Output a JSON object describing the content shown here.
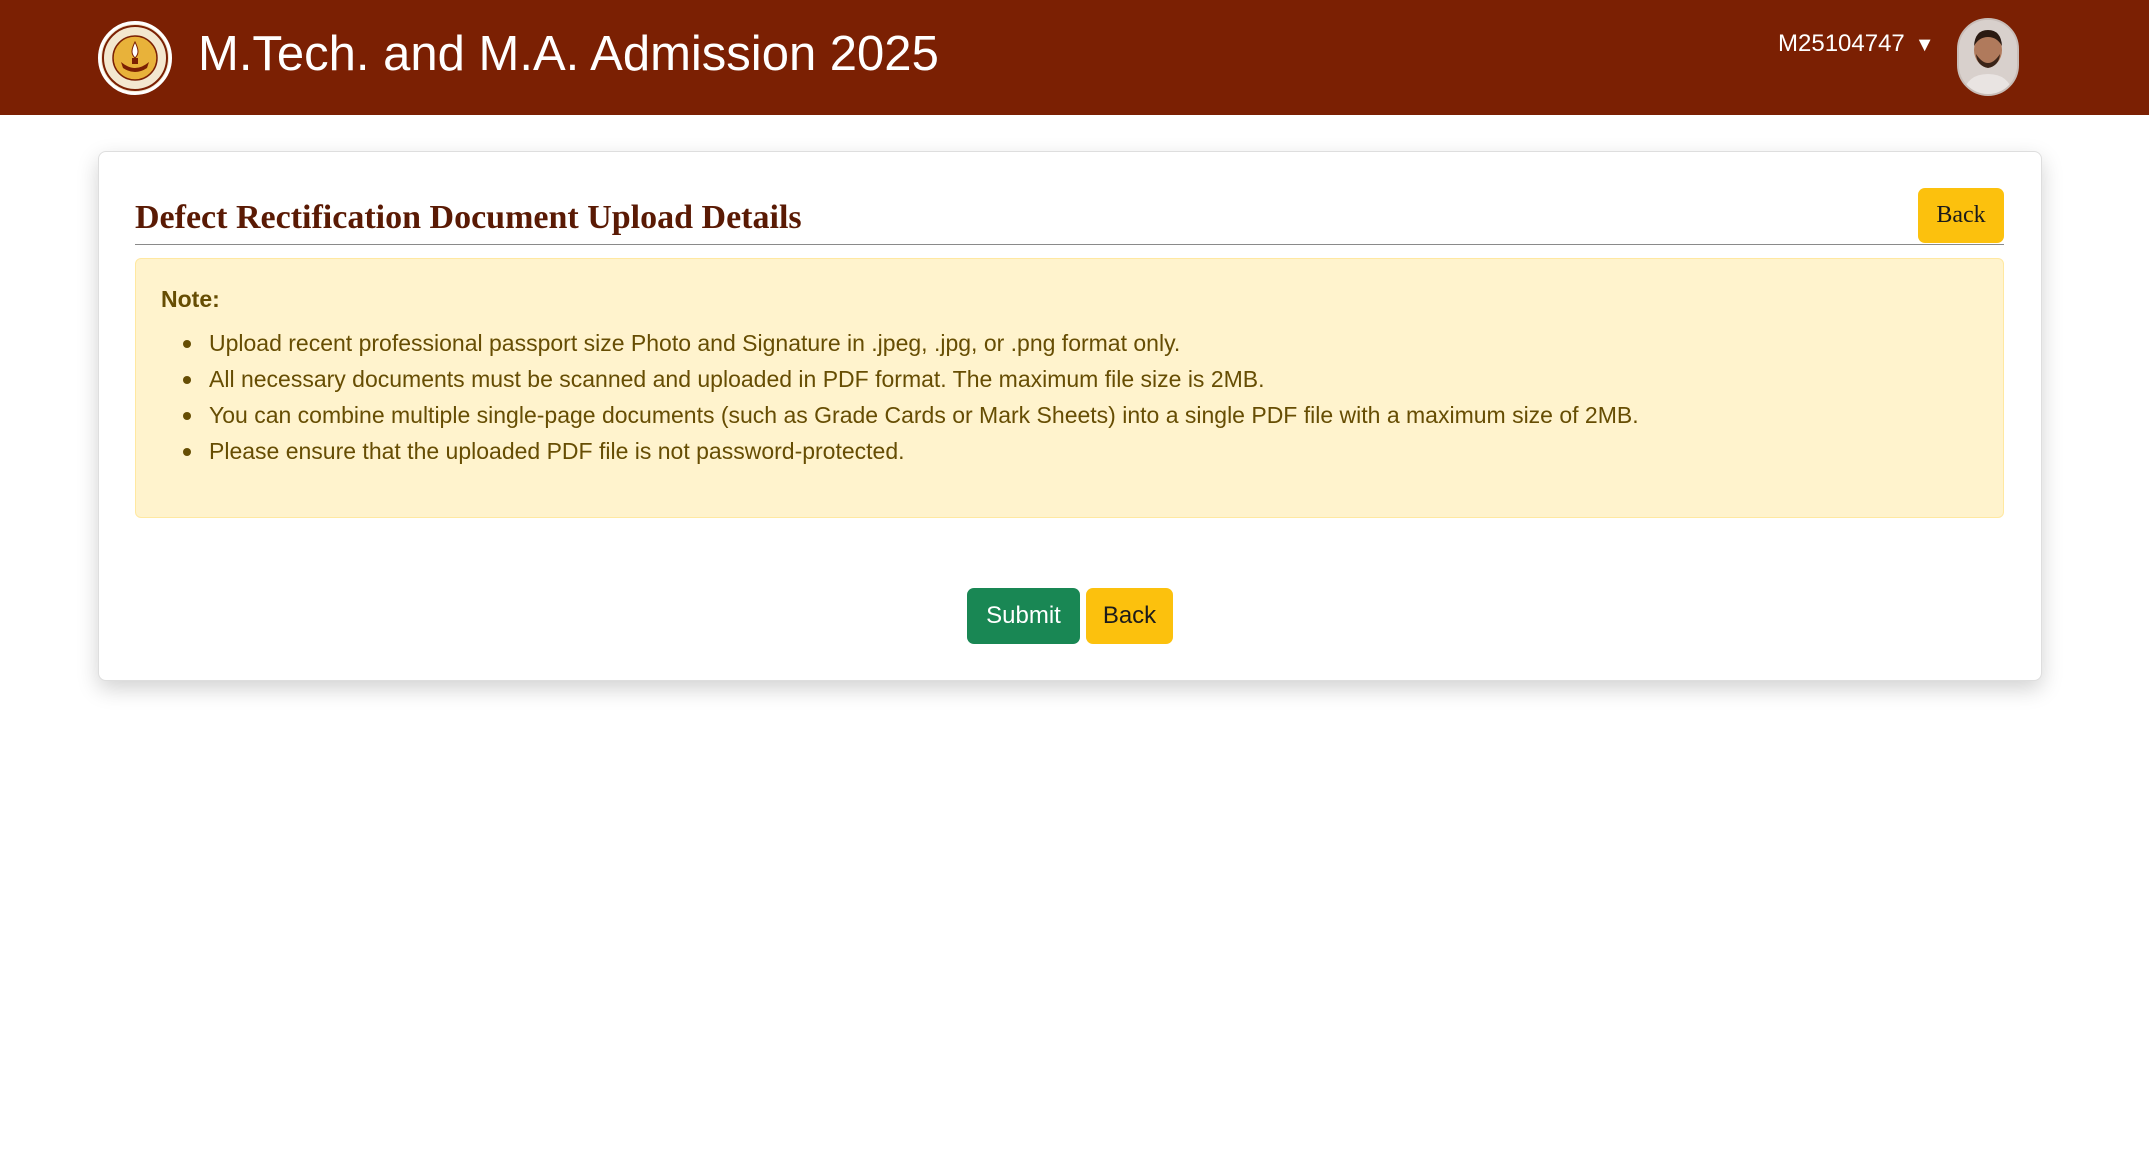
{
  "header": {
    "title": "M.Tech. and M.A. Admission 2025",
    "logo_icon": "institute-emblem-icon",
    "user_id": "M25104747",
    "caret": "▼",
    "avatar_icon": "user-avatar",
    "bg_color": "#7b2003"
  },
  "card": {
    "title": "Defect Rectification Document Upload Details",
    "back_label": "Back",
    "note": {
      "heading": "Note:",
      "items": [
        "Upload recent professional passport size Photo and Signature in .jpeg, .jpg, or .png format only.",
        "All necessary documents must be scanned and uploaded in PDF format. The maximum file size is 2MB.",
        "You can combine multiple single-page documents (such as Grade Cards or Mark Sheets) into a single PDF file with a maximum size of 2MB.",
        "Please ensure that the uploaded PDF file is not password-protected."
      ]
    },
    "actions": {
      "submit_label": "Submit",
      "back_label": "Back"
    }
  },
  "colors": {
    "submit": "#198754",
    "back": "#fcc10d",
    "note_bg": "#fff3cd",
    "note_text": "#664d03"
  }
}
